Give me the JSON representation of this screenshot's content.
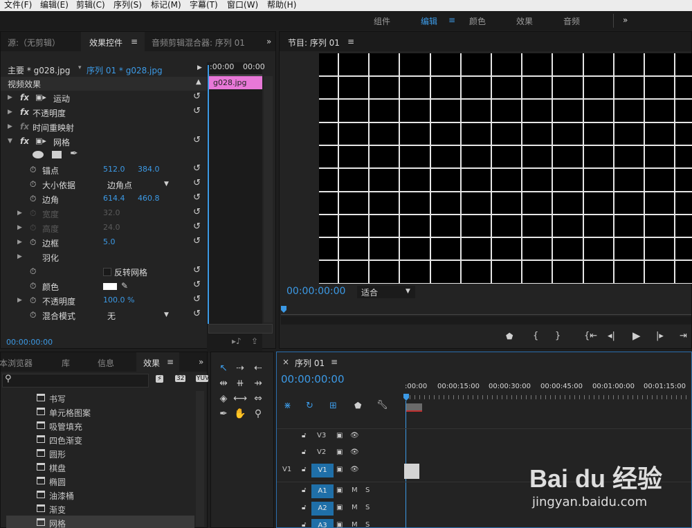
{
  "menu": [
    "文件(F)",
    "编辑(E)",
    "剪辑(C)",
    "序列(S)",
    "标记(M)",
    "字幕(T)",
    "窗口(W)",
    "帮助(H)"
  ],
  "workspaces": [
    "组件",
    "编辑",
    "颜色",
    "效果",
    "音频"
  ],
  "workspace_more": "»",
  "effect_controls": {
    "tab_source": "源:（无剪辑）",
    "tab_effects": "效果控件",
    "tab_mixer": "音频剪辑混合器: 序列 01",
    "master": "主要 * g028.jpg",
    "sequence": "序列 01 * g028.jpg",
    "time_left": ":00:00",
    "time_right": "00:00",
    "clip_name": "g028.jpg",
    "section": "视频效果",
    "motion": "运动",
    "opacity": "不透明度",
    "time_remap": "时间重映射",
    "grid": "网格",
    "anchor_label": "锚点",
    "anchor_x": "512.0",
    "anchor_y": "384.0",
    "size_from_label": "大小依据",
    "size_from_value": "边角点",
    "corner_label": "边角",
    "corner_x": "614.4",
    "corner_y": "460.8",
    "width_label": "宽度",
    "width_value": "32.0",
    "height_label": "高度",
    "height_value": "24.0",
    "border_label": "边框",
    "border_value": "5.0",
    "feather_label": "羽化",
    "invert_label": "反转网格",
    "color_label": "颜色",
    "opacity2_label": "不透明度",
    "opacity2_value": "100.0 %",
    "blend_label": "混合模式",
    "blend_value": "无",
    "timecode": "00:00:00:00"
  },
  "program": {
    "title": "节目: 序列 01",
    "timecode": "00:00:00:00",
    "fit": "适合",
    "grid_color": "#e6e6e6"
  },
  "effects_browser": {
    "tabs": [
      "本浏览器",
      "库",
      "信息",
      "效果"
    ],
    "items": [
      "书写",
      "单元格图案",
      "吸管填充",
      "四色渐变",
      "圆形",
      "棋盘",
      "椭圆",
      "油漆桶",
      "渐变",
      "网格"
    ],
    "icon_labels": [
      "32",
      "32",
      "YUV"
    ]
  },
  "timeline": {
    "title": "序列 01",
    "timecode": "00:00:00:00",
    "ruler": [
      ":00:00",
      "00:00:15:00",
      "00:00:30:00",
      "00:00:45:00",
      "00:01:00:00",
      "00:01:15:00"
    ],
    "tracks": [
      {
        "src": "",
        "name": "V3",
        "type": "video"
      },
      {
        "src": "",
        "name": "V2",
        "type": "video"
      },
      {
        "src": "V1",
        "name": "V1",
        "type": "video"
      },
      {
        "src": "",
        "name": "A1",
        "type": "audio",
        "m": "M",
        "s": "S"
      },
      {
        "src": "",
        "name": "A2",
        "type": "audio",
        "m": "M",
        "s": "S"
      },
      {
        "src": "",
        "name": "A3",
        "type": "audio",
        "m": "M",
        "s": "S"
      }
    ]
  },
  "watermark": {
    "brand": "Bai du 经验",
    "url": "jingyan.baidu.com"
  },
  "colors": {
    "accent": "#3c9ae6",
    "clip": "#e878d8",
    "track_target": "#1f6fa8"
  }
}
